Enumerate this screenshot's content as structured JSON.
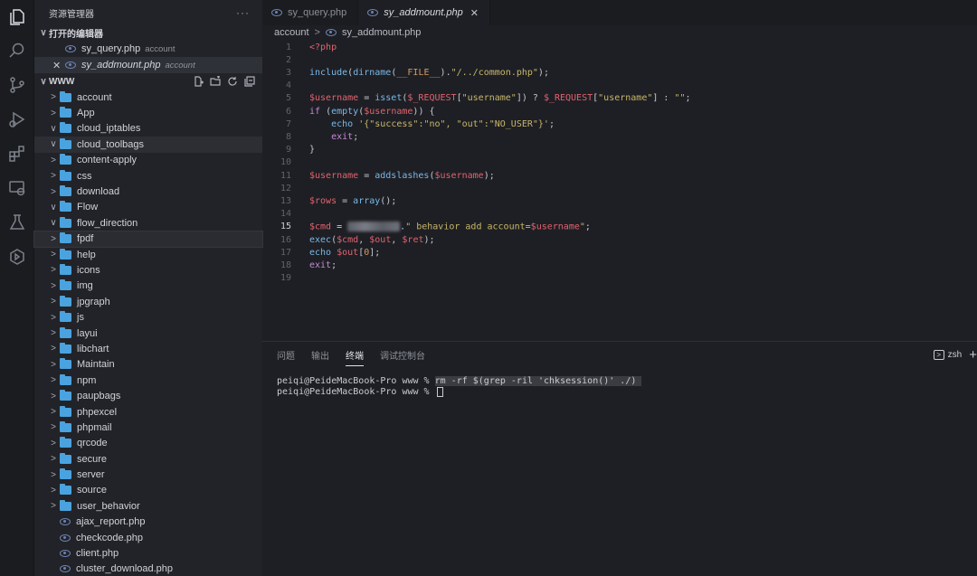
{
  "sidebar": {
    "title": "资源管理器",
    "more": "···",
    "open_editors_title": "打开的编辑器",
    "open_editors": [
      {
        "name": "sy_query.php",
        "desc": "account",
        "italic": false,
        "close": ""
      },
      {
        "name": "sy_addmount.php",
        "desc": "account",
        "italic": true,
        "close": "✕"
      }
    ],
    "folder_title": "WWW",
    "folders": [
      {
        "name": "account",
        "chev": ">"
      },
      {
        "name": "App",
        "chev": ">"
      },
      {
        "name": "cloud_iptables",
        "chev": "∨"
      },
      {
        "name": "cloud_toolbags",
        "chev": "∨"
      },
      {
        "name": "content-apply",
        "chev": ">"
      },
      {
        "name": "css",
        "chev": ">"
      },
      {
        "name": "download",
        "chev": ">"
      },
      {
        "name": "Flow",
        "chev": "∨"
      },
      {
        "name": "flow_direction",
        "chev": "∨"
      },
      {
        "name": "fpdf",
        "chev": ">"
      },
      {
        "name": "help",
        "chev": ">"
      },
      {
        "name": "icons",
        "chev": ">"
      },
      {
        "name": "img",
        "chev": ">"
      },
      {
        "name": "jpgraph",
        "chev": ">"
      },
      {
        "name": "js",
        "chev": ">"
      },
      {
        "name": "layui",
        "chev": ">"
      },
      {
        "name": "libchart",
        "chev": ">"
      },
      {
        "name": "Maintain",
        "chev": ">"
      },
      {
        "name": "npm",
        "chev": ">"
      },
      {
        "name": "paupbags",
        "chev": ">"
      },
      {
        "name": "phpexcel",
        "chev": ">"
      },
      {
        "name": "phpmail",
        "chev": ">"
      },
      {
        "name": "qrcode",
        "chev": ">"
      },
      {
        "name": "secure",
        "chev": ">"
      },
      {
        "name": "server",
        "chev": ">"
      },
      {
        "name": "source",
        "chev": ">"
      },
      {
        "name": "user_behavior",
        "chev": ">"
      }
    ],
    "files": [
      "ajax_report.php",
      "checkcode.php",
      "client.php",
      "cluster_download.php"
    ]
  },
  "tabs": [
    {
      "label": "sy_query.php",
      "active": false
    },
    {
      "label": "sy_addmount.php",
      "active": true,
      "close": "✕"
    }
  ],
  "breadcrumb": {
    "folder": "account",
    "sep": ">",
    "file": "sy_addmount.php"
  },
  "current_line": 15,
  "code_lines": [
    {
      "n": "1",
      "tokens": [
        [
          "k-tag",
          "<?php"
        ]
      ]
    },
    {
      "n": "2",
      "tokens": []
    },
    {
      "n": "3",
      "tokens": [
        [
          "k-fn",
          "include"
        ],
        [
          "k-plain",
          "("
        ],
        [
          "k-fn",
          "dirname"
        ],
        [
          "k-plain",
          "("
        ],
        [
          "k-const",
          "__FILE__"
        ],
        [
          "k-plain",
          ")."
        ],
        [
          "k-str",
          "\"/../common.php\""
        ],
        [
          "k-plain",
          ");"
        ]
      ]
    },
    {
      "n": "4",
      "tokens": []
    },
    {
      "n": "5",
      "tokens": [
        [
          "k-var",
          "$username"
        ],
        [
          "k-plain",
          " = "
        ],
        [
          "k-fn",
          "isset"
        ],
        [
          "k-plain",
          "("
        ],
        [
          "k-var",
          "$_REQUEST"
        ],
        [
          "k-plain",
          "["
        ],
        [
          "k-str",
          "\"username\""
        ],
        [
          "k-plain",
          "]) ? "
        ],
        [
          "k-var",
          "$_REQUEST"
        ],
        [
          "k-plain",
          "["
        ],
        [
          "k-str",
          "\"username\""
        ],
        [
          "k-plain",
          "] : "
        ],
        [
          "k-str",
          "\"\""
        ],
        [
          "k-plain",
          ";"
        ]
      ]
    },
    {
      "n": "6",
      "tokens": [
        [
          "k-kw",
          "if"
        ],
        [
          "k-plain",
          " ("
        ],
        [
          "k-fn",
          "empty"
        ],
        [
          "k-plain",
          "("
        ],
        [
          "k-var",
          "$username"
        ],
        [
          "k-plain",
          ")) {"
        ]
      ]
    },
    {
      "n": "7",
      "tokens": [
        [
          "k-plain",
          "    "
        ],
        [
          "k-fn",
          "echo"
        ],
        [
          "k-plain",
          " "
        ],
        [
          "k-str",
          "'{\"success\":\"no\", \"out\":\"NO_USER\"}'"
        ],
        [
          "k-plain",
          ";"
        ]
      ]
    },
    {
      "n": "8",
      "tokens": [
        [
          "k-plain",
          "    "
        ],
        [
          "k-kw",
          "exit"
        ],
        [
          "k-plain",
          ";"
        ]
      ]
    },
    {
      "n": "9",
      "tokens": [
        [
          "k-plain",
          "}"
        ]
      ]
    },
    {
      "n": "10",
      "tokens": []
    },
    {
      "n": "11",
      "tokens": [
        [
          "k-var",
          "$username"
        ],
        [
          "k-plain",
          " = "
        ],
        [
          "k-fn",
          "addslashes"
        ],
        [
          "k-plain",
          "("
        ],
        [
          "k-var",
          "$username"
        ],
        [
          "k-plain",
          ");"
        ]
      ]
    },
    {
      "n": "12",
      "tokens": []
    },
    {
      "n": "13",
      "tokens": [
        [
          "k-var",
          "$rows"
        ],
        [
          "k-plain",
          " = "
        ],
        [
          "k-fn",
          "array"
        ],
        [
          "k-plain",
          "();"
        ]
      ]
    },
    {
      "n": "14",
      "tokens": []
    },
    {
      "n": "15",
      "tokens": [
        [
          "k-var",
          "$cmd"
        ],
        [
          "k-plain",
          " = "
        ],
        [
          "blur",
          ""
        ],
        [
          "k-plain",
          "."
        ],
        [
          "k-str",
          "\" behavior add account="
        ],
        [
          "k-var",
          "$username"
        ],
        [
          "k-str",
          "\""
        ],
        [
          "k-plain",
          ";"
        ]
      ]
    },
    {
      "n": "16",
      "tokens": [
        [
          "k-fn",
          "exec"
        ],
        [
          "k-plain",
          "("
        ],
        [
          "k-var",
          "$cmd"
        ],
        [
          "k-plain",
          ", "
        ],
        [
          "k-var",
          "$out"
        ],
        [
          "k-plain",
          ", "
        ],
        [
          "k-var",
          "$ret"
        ],
        [
          "k-plain",
          ");"
        ]
      ]
    },
    {
      "n": "17",
      "tokens": [
        [
          "k-fn",
          "echo"
        ],
        [
          "k-plain",
          " "
        ],
        [
          "k-var",
          "$out"
        ],
        [
          "k-plain",
          "["
        ],
        [
          "k-const",
          "0"
        ],
        [
          "k-plain",
          "];"
        ]
      ]
    },
    {
      "n": "18",
      "tokens": [
        [
          "k-kw",
          "exit"
        ],
        [
          "k-plain",
          ";"
        ]
      ]
    },
    {
      "n": "19",
      "tokens": []
    }
  ],
  "panel": {
    "tabs": [
      "问题",
      "输出",
      "终端",
      "调试控制台"
    ],
    "active_tab": 2,
    "shell": "zsh",
    "plus": "+",
    "terminal": [
      {
        "prompt": "peiqi@PeideMacBook-Pro www % ",
        "cmd": "rm -rf $(grep -ril 'chksession()' ./) "
      },
      {
        "prompt": "peiqi@PeideMacBook-Pro www % ",
        "cmd": ""
      }
    ]
  }
}
